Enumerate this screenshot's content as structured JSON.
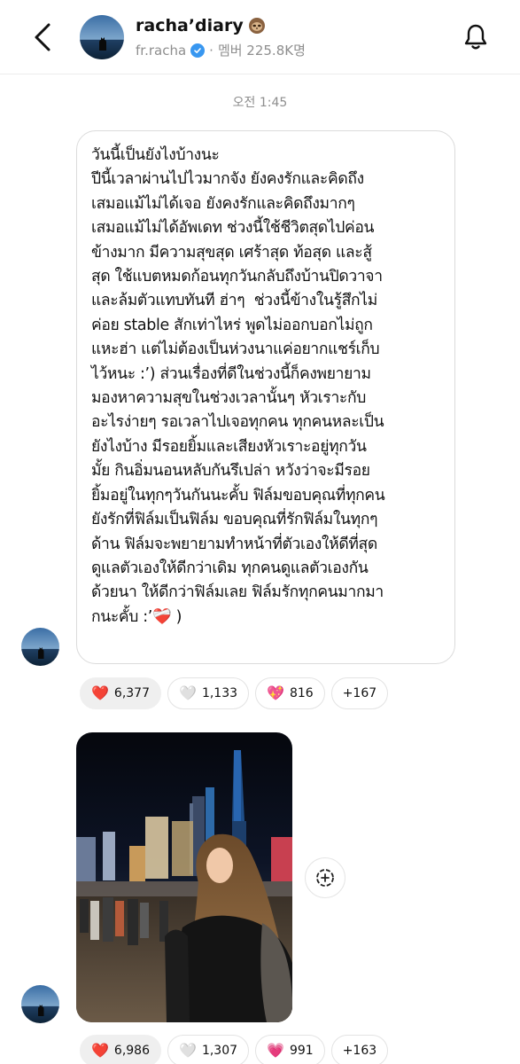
{
  "header": {
    "title": "racha’diary",
    "username": "fr.racha",
    "members_label": "멤버 225.8K명"
  },
  "timestamp": "오전 1:45",
  "message": {
    "text": "วันนี้เป็นยังไงบ้างนะ\nปีนี้เวลาผ่านไปไวมากจัง ยังคงรักและคิดถึง\nเสมอแม้ไม่ได้เจอ ยังคงรักและคิดถึงมากๆ\nเสมอแม้ไม่ได้อัพเดท ช่วงนี้ใช้ชีวิตสุดไปค่อน\nข้างมาก มีความสุขสุด เศร้าสุด ท้อสุด และสู้\nสุด ใช้แบตหมดก้อนทุกวันกลับถึงบ้านปิดวาจา\nและล้มตัวแทบทันที ฮ่าๆ  ช่วงนี้ข้างในรู้สึกไม่\nค่อย stable สักเท่าไหร่ พูดไม่ออกบอกไม่ถูก\nแหะฮ่า แต่ไม่ต้องเป็นห่วงนาแค่อยากแชร์เก็บ\nไว้หนะ :’) ส่วนเรื่องที่ดีในช่วงนี้ก็คงพยายาม\nมองหาความสุขในช่วงเวลานั้นๆ หัวเราะกับ\nอะไรง่ายๆ รอเวลาไปเจอทุกคน ทุกคนหละเป็น\nยังไงบ้าง มีรอยยิ้มและเสียงหัวเราะอยู่ทุกวัน\nมั้ย กินอิ่มนอนหลับกันรึเปล่า หวังว่าจะมีรอย\nยิ้มอยู่ในทุกๆวันกันนะคั้บ ฟิล์มขอบคุณที่ทุกคน\nยังรักที่ฟิล์มเป็นฟิล์ม ขอบคุณที่รักฟิล์มในทุกๆ\nด้าน ฟิล์มจะพยายามทำหน้าที่ตัวเองให้ดีที่สุด\nดูแลตัวเองให้ดีกว่าเดิม ทุกคนดูแลตัวเองกัน\nด้วยนา ให้ดีกว่าฟิล์มเลย ฟิล์มรักทุกคนมากมา\nกนะคั้บ :’❤️‍🩹 )"
  },
  "reactions_1": [
    {
      "icon": "red-heart",
      "emoji": "❤️",
      "count": "6,377",
      "active": true
    },
    {
      "icon": "white-heart",
      "emoji": "🤍",
      "count": "1,133",
      "active": false
    },
    {
      "icon": "sparkling-heart",
      "emoji": "💖",
      "count": "816",
      "active": false
    },
    {
      "more": "+167"
    }
  ],
  "reactions_2": [
    {
      "icon": "red-heart",
      "emoji": "❤️",
      "count": "6,986",
      "active": true
    },
    {
      "icon": "white-heart",
      "emoji": "🤍",
      "count": "1,307",
      "active": false
    },
    {
      "icon": "pink-heart",
      "emoji": "💗",
      "count": "991",
      "active": false
    },
    {
      "more": "+163"
    }
  ],
  "colors": {
    "accent_verified": "#3897f0",
    "muted_text": "#8e8e8e",
    "bubble_border": "#dbdbdb",
    "heart_red": "#e0245e"
  }
}
